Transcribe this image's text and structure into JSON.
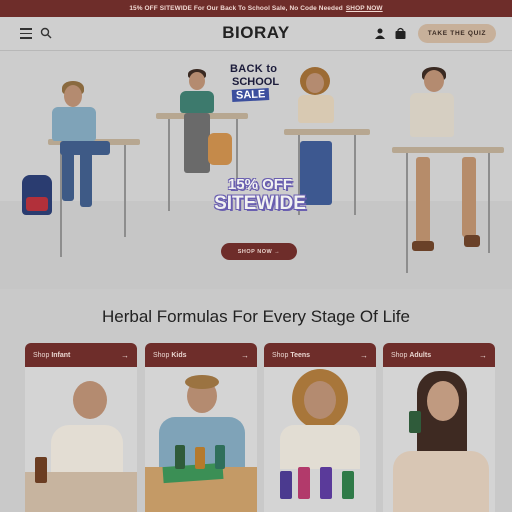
{
  "promo": {
    "text": "15% OFF SITEWIDE For Our Back To School Sale, No Code Needed",
    "cta": "SHOP NOW"
  },
  "header": {
    "logo": "BIORAY",
    "quiz_button": "TAKE THE QUIZ",
    "icons": [
      "hamburger-menu-icon",
      "search-icon",
      "account-icon",
      "cart-icon"
    ]
  },
  "hero": {
    "badge_line1": "BACK to",
    "badge_line2": "SCHOOL",
    "badge_sale": "SALE",
    "offer_line1": "15% OFF",
    "offer_line2": "SITEWIDE",
    "cta": "SHOP NOW →"
  },
  "section": {
    "heading": "Herbal Formulas For Every Stage Of Life"
  },
  "cards": [
    {
      "label_prefix": "Shop",
      "label_bold": "Infant",
      "arrow": "→"
    },
    {
      "label_prefix": "Shop",
      "label_bold": "Kids",
      "arrow": "→"
    },
    {
      "label_prefix": "Shop",
      "label_bold": "Teens",
      "arrow": "→"
    },
    {
      "label_prefix": "Shop",
      "label_bold": "Adults",
      "arrow": "→"
    }
  ],
  "colors": {
    "brand": "#6e2d2a",
    "quiz": "#c7b09a",
    "sale_blue": "#3c4f9e",
    "offer_purple": "#6a5fb0"
  }
}
